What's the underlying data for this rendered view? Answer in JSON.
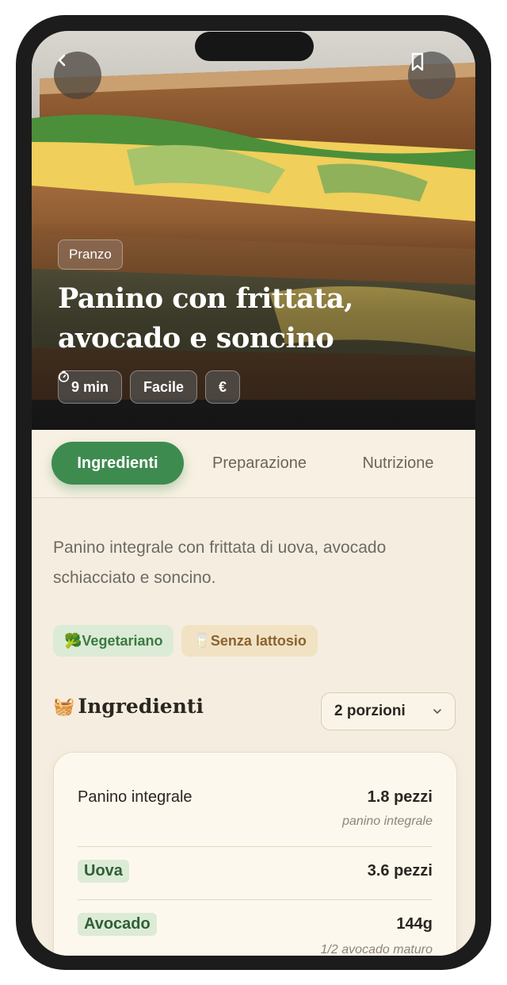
{
  "hero": {
    "category": "Pranzo",
    "title": "Panino con frittata, avocado e soncino",
    "meta": [
      {
        "icon": "timer-icon",
        "label": "9 min"
      },
      {
        "label": "Facile"
      },
      {
        "label": "€"
      }
    ]
  },
  "tabs": [
    "Ingredienti",
    "Preparazione",
    "Nutrizione"
  ],
  "active_tab": "Ingredienti",
  "description": "Panino integrale con frittata di uova, avocado schiacciato e soncino.",
  "tags": [
    {
      "emoji": "🥦",
      "label": "Vegetariano"
    },
    {
      "emoji": "🥛",
      "label": "Senza lattosio"
    }
  ],
  "ingredients_section": {
    "emoji": "🧺",
    "title": "Ingredienti",
    "portions": "2 porzioni"
  },
  "ingredients": [
    {
      "name": "Panino integrale",
      "qty": "1.8 pezzi",
      "note": "panino integrale"
    },
    {
      "name": "Uova",
      "qty": "3.6 pezzi",
      "note": ""
    },
    {
      "name": "Avocado",
      "qty": "144g",
      "note": "1/2 avocado maturo"
    }
  ],
  "colors": {
    "primary_green": "#3e8b4f",
    "background": "#f5eee0"
  }
}
